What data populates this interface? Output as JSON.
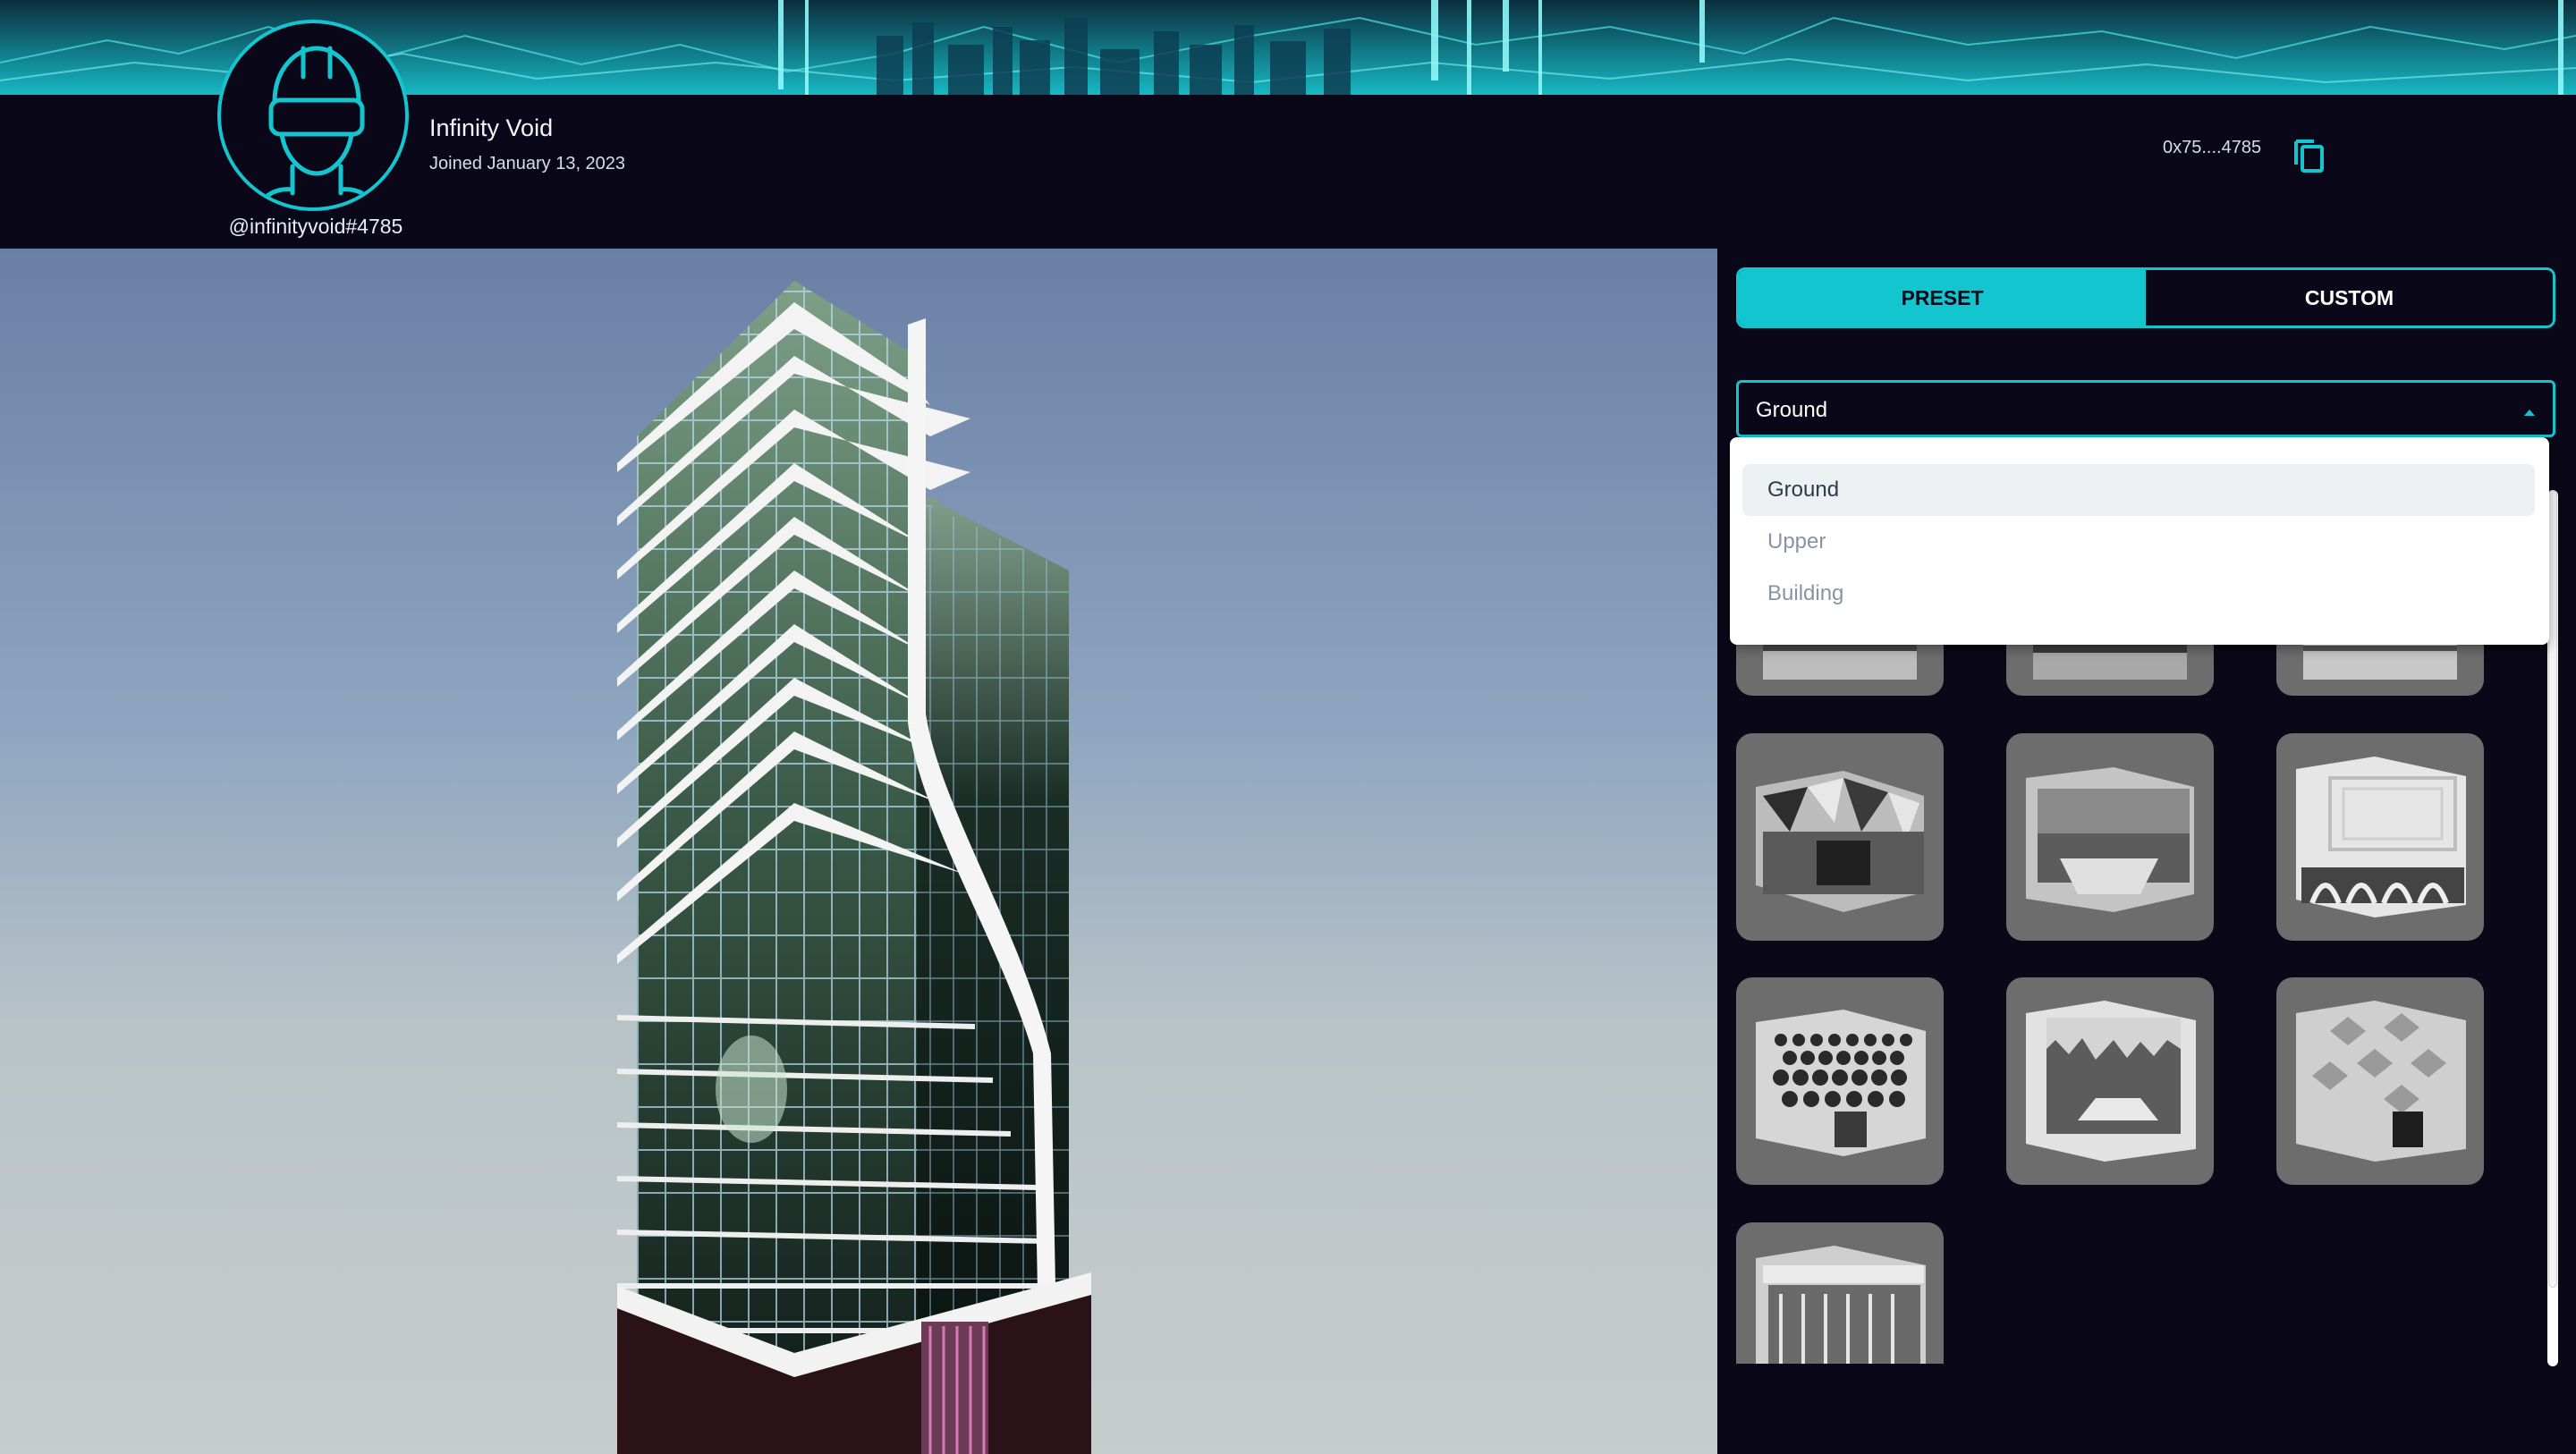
{
  "profile": {
    "display_name": "Infinity Void",
    "joined": "Joined January 13, 2023",
    "username": "@infinityvoid#4785",
    "wallet": "0x75....4785"
  },
  "icons": {
    "avatar": "vr-headset-avatar-icon",
    "copy": "copy-icon",
    "caret": "caret-up-icon"
  },
  "panel": {
    "tabs": [
      {
        "label": "PRESET",
        "active": true
      },
      {
        "label": "CUSTOM",
        "active": false
      }
    ],
    "select": {
      "value": "Ground",
      "options": [
        "Ground",
        "Upper",
        "Building"
      ]
    }
  },
  "colors": {
    "accent": "#13c5ce",
    "background": "#0a0718",
    "tile": "#6d6d6d"
  }
}
